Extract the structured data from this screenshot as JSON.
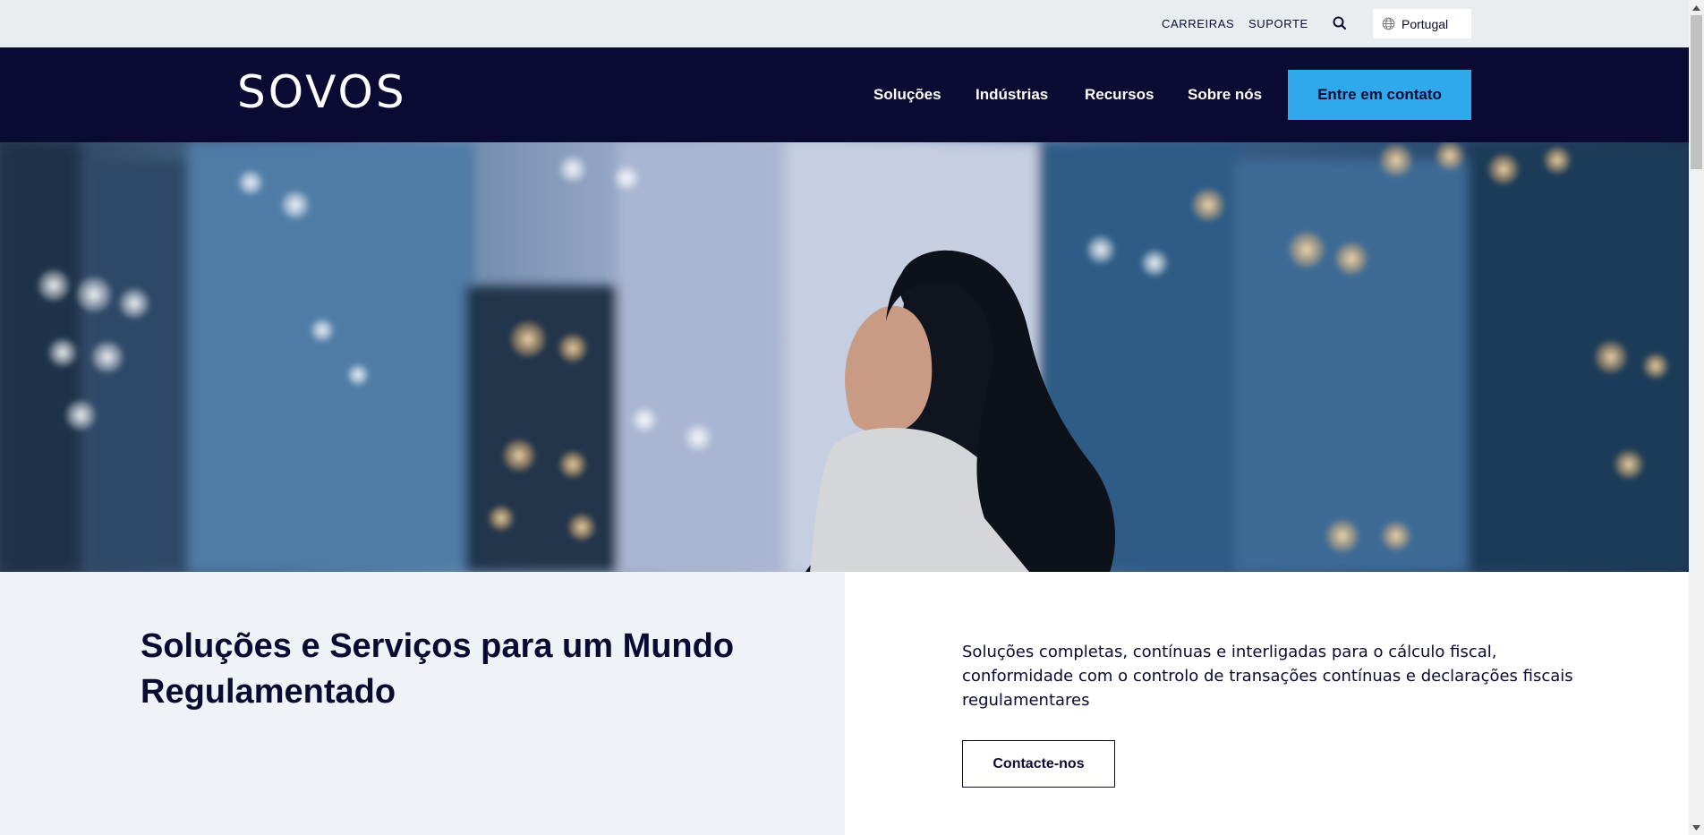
{
  "utility_bar": {
    "careers": "CARREIRAS",
    "support": "SUPORTE",
    "search_icon": "search-icon",
    "language": "Portugal",
    "language_icon": "globe-icon"
  },
  "nav": {
    "logo": "SOVOS",
    "items": [
      "Soluções",
      "Indústrias",
      "Recursos",
      "Sobre nós"
    ],
    "cta": "Entre em contato"
  },
  "hero": {
    "image": "photo-woman-city-night"
  },
  "content": {
    "headline": "Soluções e Serviços para um Mundo Regulamentado",
    "description": "Soluções completas, contínuas e interligadas para o cálculo fiscal, conformidade com o controlo de transações contínuas e declarações fiscais regulamentares",
    "button": "Contacte-nos"
  },
  "colors": {
    "navy": "#0a0a32",
    "accent": "#2fa8ec",
    "utility_bg": "#e9edf0",
    "light_panel": "#eff3f7"
  }
}
